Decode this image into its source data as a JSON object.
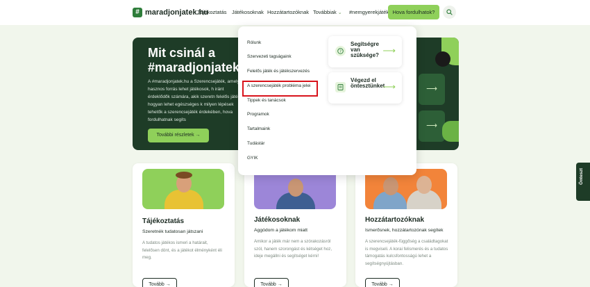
{
  "header": {
    "logo_mark": "#",
    "logo_text": "maradjonjatek.hu",
    "nav": {
      "tajekoztatas": "Tájékoztatás",
      "jatekosoknak": "Játékosoknak",
      "hozzatartozoknak": "Hozzátartozóknak",
      "tovabbiak": "Továbbiak",
      "hashtag": "#nemgyerekjáték"
    },
    "cta": "Hova fordulhatok?"
  },
  "hero": {
    "title": "Mit csinál a #maradjonjatek",
    "text": "A #maradjonjatek.hu a Szerencsejáték, amely hasznos forrás lehet játékosok, h iránt érdeklődők számára, akik szeretn felelős játék, hogyan lehet egészséges k milyen lépések tehetők a szerencsejáték érdekében, hova fordulhatnak segíts",
    "button": "További részletek →",
    "card_arrow": "⟶"
  },
  "dropdown": {
    "items": [
      "Rólunk",
      "Szervezeti tagságaink",
      "Felelős játék és játékszervezés",
      "A szerencsejáték probléma jelei",
      "Tippek és tanácsok",
      "Programok",
      "Tartalmaink",
      "Tudástár",
      "GYIK"
    ],
    "side_cards": [
      {
        "label": "Segítségre van szüksége?",
        "arrow": "⟶"
      },
      {
        "label": "Végezd el önteszt­ünket",
        "arrow": "⟶"
      }
    ]
  },
  "side_tab": {
    "label": "Önteszt"
  },
  "cards": [
    {
      "title": "Tájékoztatás",
      "subtitle": "Szeretnék tudatosan játszani",
      "text": "A tudatos játékos ismeri a határait, felelősen dönt, és a játékot élményként éli meg.",
      "button": "Tovább →"
    },
    {
      "title": "Játékosoknak",
      "subtitle": "Aggódom a játékom miatt",
      "text": "Amikor a játék már nem a szórakozásról szól, hanem szorongást és kétséget hoz, ideje megállni és segítséget kérni!",
      "button": "Tovább →"
    },
    {
      "title": "Hozzátartozóknak",
      "subtitle": "Ismerősnek, hozzátartozónak segítek",
      "text": "A szerencsejáték-függőség a családtagokat is megviseli. A korai felismerés és a tudatos támogatás kulcsfontosságú lehet a segítségnyújtásban.",
      "button": "Tovább →"
    }
  ],
  "colors": {
    "brand_green": "#8fd05a",
    "dark_green": "#1e3c27",
    "highlight_red": "#d8131b"
  }
}
